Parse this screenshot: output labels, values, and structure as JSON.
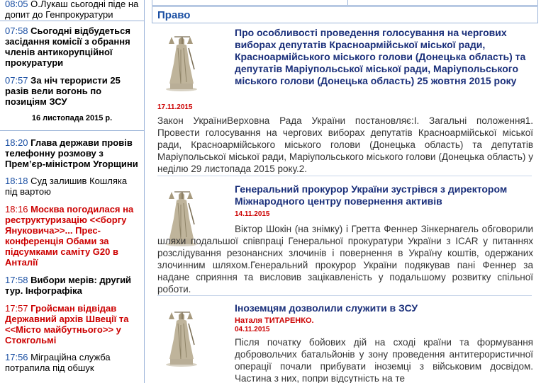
{
  "left_news": [
    {
      "time": "08:05",
      "text": "О.Лукаш сьогодні піде на допит до Генпрокуратури",
      "style": "normal"
    },
    {
      "time": "07:58",
      "text": "Сьогодні відбудеться засідання комісії з обрання членів антикорупційної прокуратури",
      "style": "bold"
    },
    {
      "time": "07:57",
      "text": "За ніч терористи 25 разів вели вогонь по позиціям ЗСУ",
      "style": "bold"
    },
    {
      "time": "18:20",
      "text": "Глава держави провів телефонну розмову з Прем’єр-міністром Угорщини",
      "style": "bold"
    },
    {
      "time": "18:18",
      "text": "Суд залишив Кошляка під вартою",
      "style": "normal"
    },
    {
      "time": "18:16",
      "text": "Москва погодилася на реструктуризацію <<боргу Януковича>>... Прес-конференція Обами за підсумками саміту G20 в Анталії",
      "style": "red"
    },
    {
      "time": "17:58",
      "text": "Вибори мерів: другий тур. Інфографіка",
      "style": "bold"
    },
    {
      "time": "17:57",
      "text": "Гройсман відвідав Державний архів Швеції та <<Місто майбутнього>> у Стокгольмі",
      "style": "red"
    },
    {
      "time": "17:56",
      "text": "Міграційна служба потрапила під обшук",
      "style": "normal"
    }
  ],
  "date_separator": "16 листопада 2015 р.",
  "section": {
    "title": "Право"
  },
  "articles": [
    {
      "title": "Про особливості проведення голосування на чергових виборах депутатів Красноармійської міської ради, Красноармійського міського голови (Донецька область) та депутатів Маріупольської міської ради, Маріупольського міського голови (Донецька область) 25 жовтня 2015 року",
      "author": "",
      "date": "17.11.2015",
      "body": "Закон УкраїниВерховна Рада України постановляє:І. Загальні положення1. Провести голосування на чергових виборах депутатів Красноармійської міської ради, Красноармійського міського голови (Донецька область) та депутатів Маріупольської міської ради, Маріупольського міського голови (Донецька область) у неділю 29 листопада 2015 року.2."
    },
    {
      "title": "Генеральний прокурор України зустрівся з директором Міжнародного центру повернення активів",
      "author": "",
      "date": "14.11.2015",
      "body": "Віктор Шокін (на знімку) і Гретта Феннер Зінкернагель обговорили шляхи подальшої співпраці Генеральної прокуратури України з ICAR у питаннях розслідування резонансних злочинів і повернення в Україну коштів, одержаних злочинним шляхом.Генеральний прокурор України подякував пані Феннер за надане сприяння та висловив зацікавленість у подальшому розвитку спільної роботи."
    },
    {
      "title": "Іноземцям дозволили служити в ЗСУ",
      "author": "Наталя ТИТАРЕНКО.",
      "date": "04.11.2015",
      "body": "Після початку бойових дій на сході країни та формування добровольчих батальйонів у зону проведення антитерористичної операції почали прибувати іноземці з військовим досвідом. Частина з них, попри відсутність на те"
    }
  ]
}
